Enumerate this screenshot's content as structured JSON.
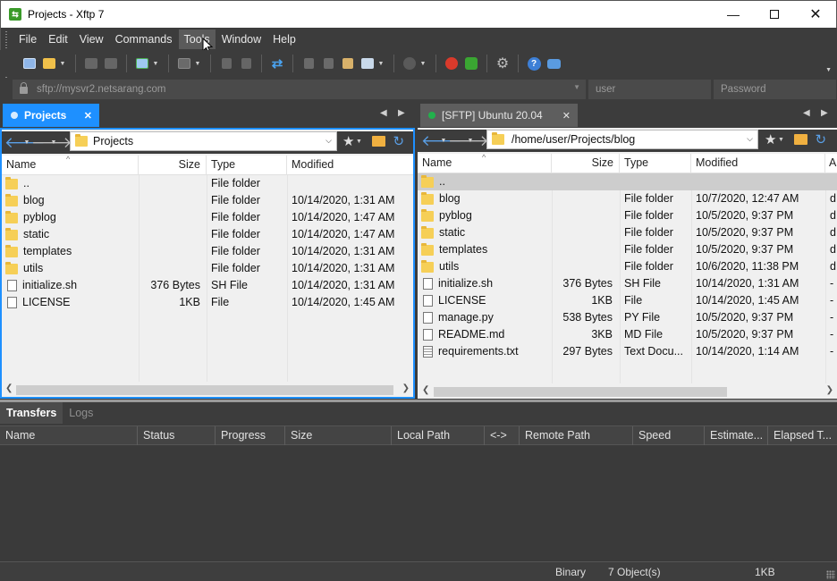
{
  "window": {
    "title": "Projects - Xftp 7",
    "controls": [
      "minimize-icon",
      "maximize-icon",
      "close-icon"
    ]
  },
  "menu": [
    "File",
    "Edit",
    "View",
    "Commands",
    "Tools",
    "Window",
    "Help"
  ],
  "address": {
    "host": "sftp://mysvr2.netsarang.com",
    "user_placeholder": "user",
    "password_placeholder": "Password"
  },
  "colors": {
    "accent": "#1e90ff",
    "active_tab": "#1e90ff",
    "connected_dot": "#22b14c",
    "folder": "#f6cf57"
  },
  "left_pane": {
    "tab_label": "Projects",
    "path": "Projects",
    "columns": [
      "Name",
      "Size",
      "Type",
      "Modified"
    ],
    "rows": [
      {
        "name": "..",
        "size": "",
        "type": "File folder",
        "modified": "",
        "icon": "folder"
      },
      {
        "name": "blog",
        "size": "",
        "type": "File folder",
        "modified": "10/14/2020, 1:31 AM",
        "icon": "folder"
      },
      {
        "name": "pyblog",
        "size": "",
        "type": "File folder",
        "modified": "10/14/2020, 1:47 AM",
        "icon": "folder"
      },
      {
        "name": "static",
        "size": "",
        "type": "File folder",
        "modified": "10/14/2020, 1:47 AM",
        "icon": "folder"
      },
      {
        "name": "templates",
        "size": "",
        "type": "File folder",
        "modified": "10/14/2020, 1:31 AM",
        "icon": "folder"
      },
      {
        "name": "utils",
        "size": "",
        "type": "File folder",
        "modified": "10/14/2020, 1:31 AM",
        "icon": "folder"
      },
      {
        "name": "initialize.sh",
        "size": "376 Bytes",
        "type": "SH File",
        "modified": "10/14/2020, 1:31 AM",
        "icon": "file"
      },
      {
        "name": "LICENSE",
        "size": "1KB",
        "type": "File",
        "modified": "10/14/2020, 1:45 AM",
        "icon": "file"
      }
    ]
  },
  "right_pane": {
    "tab_label": "[SFTP] Ubuntu 20.04",
    "path": "/home/user/Projects/blog",
    "columns": [
      "Name",
      "Size",
      "Type",
      "Modified",
      "A"
    ],
    "rows": [
      {
        "name": "..",
        "size": "",
        "type": "",
        "modified": "",
        "attr": "",
        "icon": "folder",
        "selected": true
      },
      {
        "name": "blog",
        "size": "",
        "type": "File folder",
        "modified": "10/7/2020, 12:47 AM",
        "attr": "d",
        "icon": "folder"
      },
      {
        "name": "pyblog",
        "size": "",
        "type": "File folder",
        "modified": "10/5/2020, 9:37 PM",
        "attr": "d",
        "icon": "folder"
      },
      {
        "name": "static",
        "size": "",
        "type": "File folder",
        "modified": "10/5/2020, 9:37 PM",
        "attr": "d",
        "icon": "folder"
      },
      {
        "name": "templates",
        "size": "",
        "type": "File folder",
        "modified": "10/5/2020, 9:37 PM",
        "attr": "d",
        "icon": "folder"
      },
      {
        "name": "utils",
        "size": "",
        "type": "File folder",
        "modified": "10/6/2020, 11:38 PM",
        "attr": "d",
        "icon": "folder"
      },
      {
        "name": "initialize.sh",
        "size": "376 Bytes",
        "type": "SH File",
        "modified": "10/14/2020, 1:31 AM",
        "attr": "-",
        "icon": "file"
      },
      {
        "name": "LICENSE",
        "size": "1KB",
        "type": "File",
        "modified": "10/14/2020, 1:45 AM",
        "attr": "-",
        "icon": "file"
      },
      {
        "name": "manage.py",
        "size": "538 Bytes",
        "type": "PY File",
        "modified": "10/5/2020, 9:37 PM",
        "attr": "-",
        "icon": "file"
      },
      {
        "name": "README.md",
        "size": "3KB",
        "type": "MD File",
        "modified": "10/5/2020, 9:37 PM",
        "attr": "-",
        "icon": "file"
      },
      {
        "name": "requirements.txt",
        "size": "297 Bytes",
        "type": "Text Docu...",
        "modified": "10/14/2020, 1:14 AM",
        "attr": "-",
        "icon": "textfile"
      }
    ]
  },
  "transfers": {
    "tabs": [
      "Transfers",
      "Logs"
    ],
    "columns": [
      "Name",
      "Status",
      "Progress",
      "Size",
      "Local Path",
      "<->",
      "Remote Path",
      "Speed",
      "Estimate...",
      "Elapsed T..."
    ]
  },
  "status": {
    "mode": "Binary",
    "objects": "7 Object(s)",
    "size": "1KB"
  }
}
